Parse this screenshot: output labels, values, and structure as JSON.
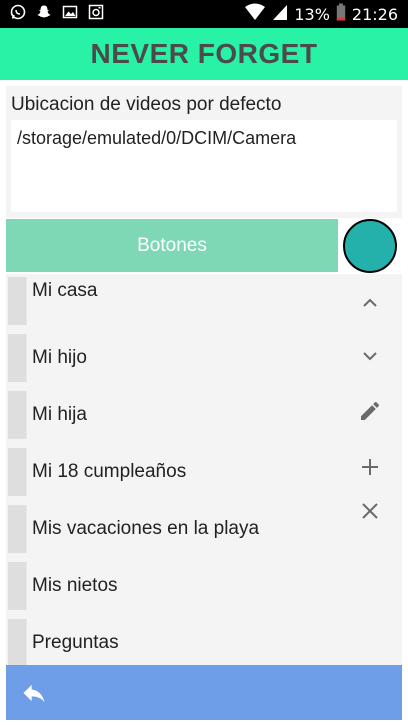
{
  "status_bar": {
    "icons": [
      "whatsapp-icon",
      "snapchat-icon",
      "image-icon",
      "camera-icon"
    ],
    "battery": "13%",
    "time": "21:26"
  },
  "app": {
    "title": "NEVER FORGET"
  },
  "video_location": {
    "label": "Ubicacion de videos por defecto",
    "path": "/storage/emulated/0/DCIM/Camera"
  },
  "botones_label": "Botones",
  "list": [
    {
      "label": "Mi casa"
    },
    {
      "label": "Mi hijo"
    },
    {
      "label": "Mi hija"
    },
    {
      "label": "Mi 18 cumpleaños"
    },
    {
      "label": "Mis vacaciones en la playa"
    },
    {
      "label": "Mis nietos"
    },
    {
      "label": "Preguntas"
    }
  ],
  "side_actions": [
    "chevron-up-icon",
    "chevron-down-icon",
    "edit-icon",
    "add-icon",
    "close-icon"
  ],
  "colors": {
    "appbar": "#27f2a6",
    "botones": "#7ed8b6",
    "circle": "#25b1ab",
    "bottombar": "#6f9ee8"
  }
}
